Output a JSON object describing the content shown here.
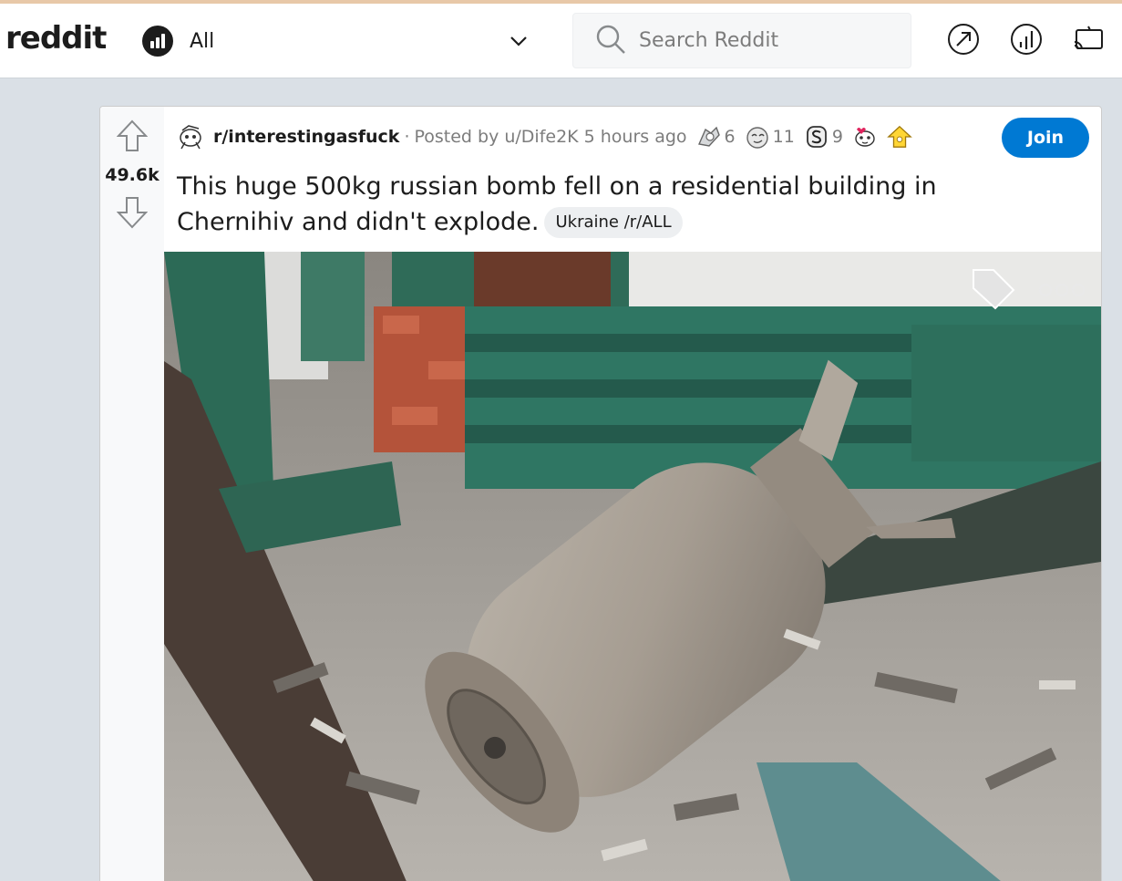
{
  "header": {
    "logo_text": "reddit",
    "feed_label": "All",
    "search_placeholder": "Search Reddit",
    "icons": [
      "feed-icon",
      "chevron-down-icon",
      "search-icon",
      "popular-arrow-icon",
      "all-chart-icon",
      "cast-icon"
    ]
  },
  "post": {
    "score": "49.6k",
    "subreddit": "r/interestingasfuck",
    "separator": "·",
    "posted_by_prefix": "Posted by",
    "username": "u/Dife2K",
    "age": "5 hours ago",
    "awards": [
      {
        "icon": "silver-award-icon",
        "count": "6"
      },
      {
        "icon": "helpful-award-icon",
        "count": "11"
      },
      {
        "icon": "wholesome-award-icon",
        "count": "9"
      },
      {
        "icon": "heart-award-icon",
        "count": ""
      },
      {
        "icon": "gold-award-icon",
        "count": ""
      }
    ],
    "join_label": "Join",
    "title": "This huge 500kg russian bomb fell on a residential building in Chernihiv and didn't explode.",
    "flair": "Ukraine /r/ALL"
  },
  "colors": {
    "page_bg": "#dae0e6",
    "accent": "#0079d3",
    "text": "#1c1c1c",
    "muted": "#7c7c7c"
  }
}
